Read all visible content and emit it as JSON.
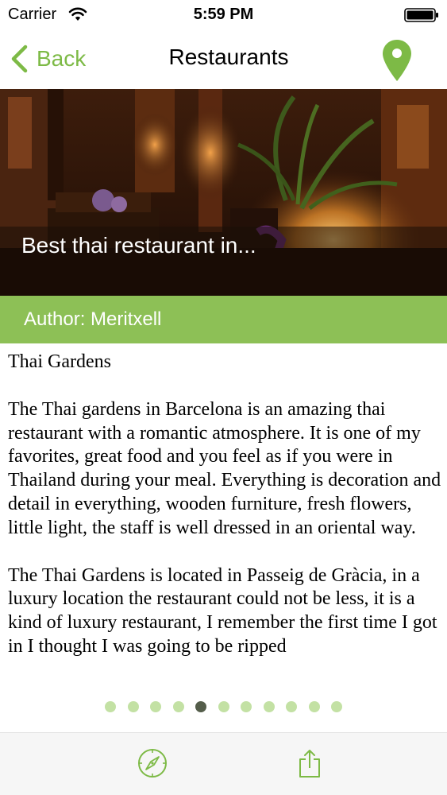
{
  "status_bar": {
    "carrier": "Carrier",
    "time": "5:59 PM",
    "icons": [
      "wifi-icon",
      "battery-icon"
    ]
  },
  "nav": {
    "back_label": "Back",
    "title": "Restaurants",
    "right_icon": "map-pin-icon"
  },
  "hero": {
    "caption": "Best thai restaurant in..."
  },
  "author": {
    "label": "Author: Meritxell"
  },
  "article": {
    "title": "Thai Gardens",
    "paragraphs": [
      "The Thai gardens in Barcelona is an amazing thai restaurant with a romantic atmosphere. It is one of my favorites, great food and you feel as if you were in Thailand during your meal. Everything is decoration and detail in everything, wooden furniture, fresh flowers, little light, the staff is well dressed in an oriental way.",
      "The Thai Gardens is located in Passeig de Gràcia, in a luxury location the restaurant could not be less, it is a kind of luxury restaurant, I remember the first time I got in I thought I was going to be ripped"
    ]
  },
  "pagination": {
    "total": 11,
    "current": 5
  },
  "toolbar": {
    "icons": [
      "compass-icon",
      "share-icon"
    ]
  },
  "colors": {
    "accent": "#7dba46",
    "author_bar": "#8dc056",
    "dot_inactive": "#c3e1a4",
    "dot_active": "#545d4a"
  }
}
